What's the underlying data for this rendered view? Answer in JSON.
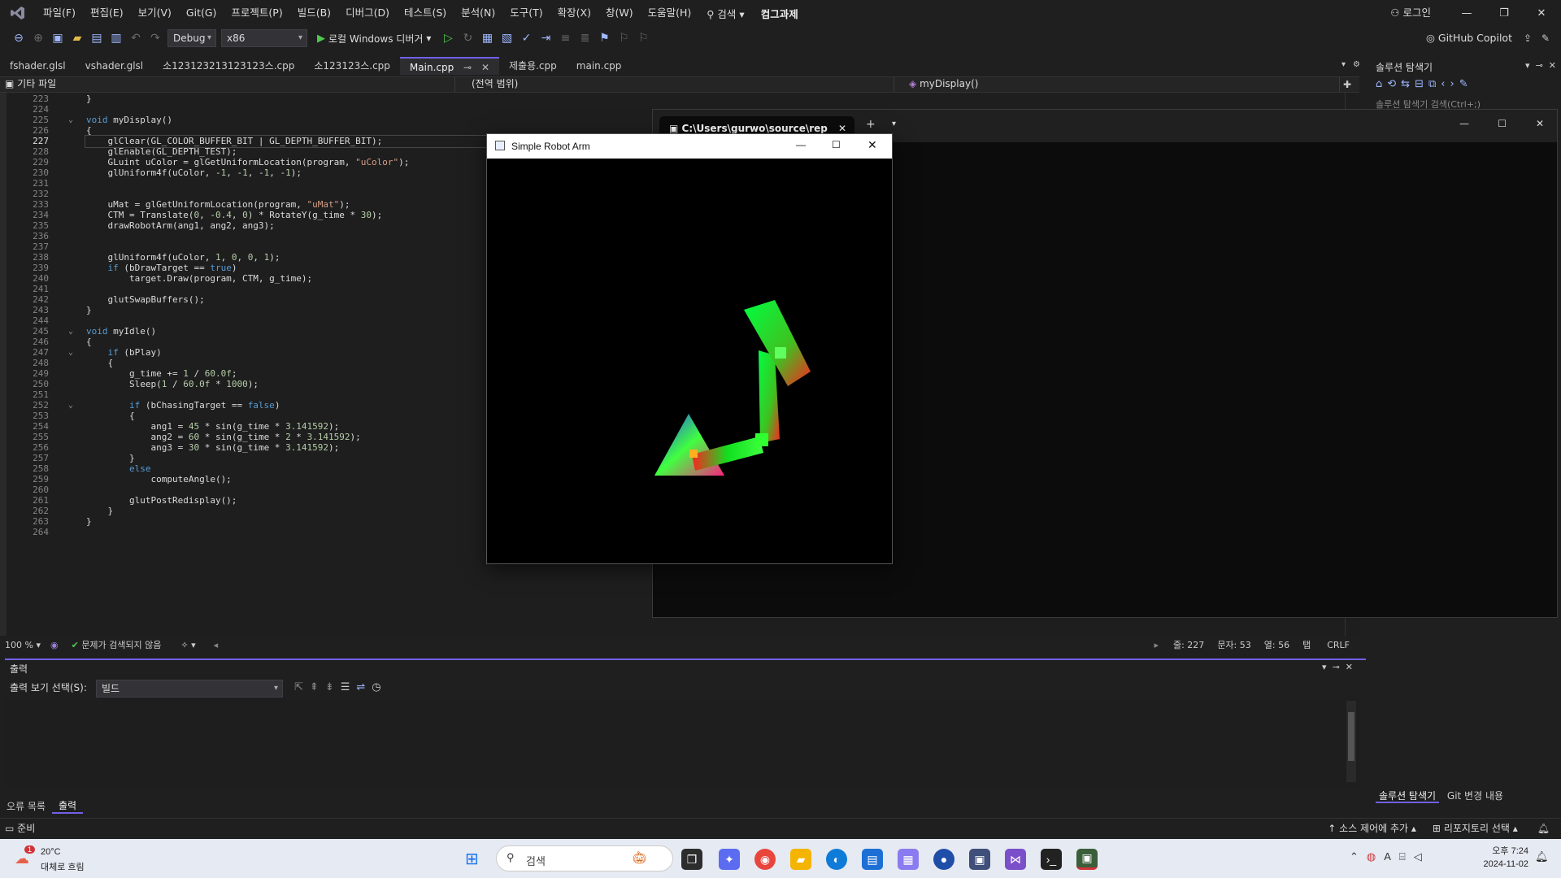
{
  "menubar": {
    "items": [
      "파일(F)",
      "편집(E)",
      "보기(V)",
      "Git(G)",
      "프로젝트(P)",
      "빌드(B)",
      "디버그(D)",
      "테스트(S)",
      "분석(N)",
      "도구(T)",
      "확장(X)",
      "창(W)",
      "도움말(H)"
    ],
    "search": "검색",
    "solution_name": "컴그과제",
    "login": "로그인"
  },
  "toolbar": {
    "config": "Debug",
    "platform": "x86",
    "run_label": "로컬 Windows 디버거",
    "copilot": "GitHub Copilot"
  },
  "tabs": [
    {
      "label": "fshader.glsl"
    },
    {
      "label": "vshader.glsl"
    },
    {
      "label": "소123123213123123스.cpp"
    },
    {
      "label": "소123123스.cpp"
    },
    {
      "label": "Main.cpp",
      "active": true
    },
    {
      "label": "제출용.cpp"
    },
    {
      "label": "main.cpp"
    }
  ],
  "navbar": {
    "project": "기타 파일",
    "scope": "(전역 범위)",
    "member": "myDisplay()"
  },
  "editor": {
    "current_line": 227,
    "lines": [
      {
        "n": "223",
        "t": "}"
      },
      {
        "n": "224",
        "t": ""
      },
      {
        "n": "225",
        "t": "void myDisplay()"
      },
      {
        "n": "226",
        "t": "{"
      },
      {
        "n": "227",
        "t": "    glClear(GL_COLOR_BUFFER_BIT | GL_DEPTH_BUFFER_BIT);"
      },
      {
        "n": "228",
        "t": "    glEnable(GL_DEPTH_TEST);"
      },
      {
        "n": "229",
        "t": "    GLuint uColor = glGetUniformLocation(program, \"uColor\");"
      },
      {
        "n": "230",
        "t": "    glUniform4f(uColor, -1, -1, -1, -1);"
      },
      {
        "n": "231",
        "t": ""
      },
      {
        "n": "232",
        "t": ""
      },
      {
        "n": "233",
        "t": "    uMat = glGetUniformLocation(program, \"uMat\");"
      },
      {
        "n": "234",
        "t": "    CTM = Translate(0, -0.4, 0) * RotateY(g_time * 30);"
      },
      {
        "n": "235",
        "t": "    drawRobotArm(ang1, ang2, ang3);"
      },
      {
        "n": "236",
        "t": ""
      },
      {
        "n": "237",
        "t": ""
      },
      {
        "n": "238",
        "t": "    glUniform4f(uColor, 1, 0, 0, 1);"
      },
      {
        "n": "239",
        "t": "    if (bDrawTarget == true)"
      },
      {
        "n": "240",
        "t": "        target.Draw(program, CTM, g_time);"
      },
      {
        "n": "241",
        "t": ""
      },
      {
        "n": "242",
        "t": "    glutSwapBuffers();"
      },
      {
        "n": "243",
        "t": "}"
      },
      {
        "n": "244",
        "t": ""
      },
      {
        "n": "245",
        "t": "void myIdle()"
      },
      {
        "n": "246",
        "t": "{"
      },
      {
        "n": "247",
        "t": "    if (bPlay)"
      },
      {
        "n": "248",
        "t": "    {"
      },
      {
        "n": "249",
        "t": "        g_time += 1 / 60.0f;"
      },
      {
        "n": "250",
        "t": "        Sleep(1 / 60.0f * 1000);"
      },
      {
        "n": "251",
        "t": ""
      },
      {
        "n": "252",
        "t": "        if (bChasingTarget == false)"
      },
      {
        "n": "253",
        "t": "        {"
      },
      {
        "n": "254",
        "t": "            ang1 = 45 * sin(g_time * 3.141592);"
      },
      {
        "n": "255",
        "t": "            ang2 = 60 * sin(g_time * 2 * 3.141592);"
      },
      {
        "n": "256",
        "t": "            ang3 = 30 * sin(g_time * 3.141592);"
      },
      {
        "n": "257",
        "t": "        }"
      },
      {
        "n": "258",
        "t": "        else"
      },
      {
        "n": "259",
        "t": "            computeAngle();"
      },
      {
        "n": "260",
        "t": ""
      },
      {
        "n": "261",
        "t": "        glutPostRedisplay();"
      },
      {
        "n": "262",
        "t": "    }"
      },
      {
        "n": "263",
        "t": "}"
      },
      {
        "n": "264",
        "t": ""
      }
    ],
    "zoom": "100 %",
    "issues": "문제가 검색되지 않음",
    "pos_line": "줄: 227",
    "pos_char": "문자: 53",
    "pos_col": "열: 56",
    "indent": "탭",
    "eol": "CRLF"
  },
  "output": {
    "title": "출력",
    "source_label": "출력 보기 선택(S):",
    "source_value": "빌드"
  },
  "bottom_tabs": [
    "오류 목록",
    "출력"
  ],
  "solution_explorer": {
    "title": "솔루션 탐색기",
    "search_placeholder": "솔루션 탐색기 검색(Ctrl+;)",
    "bottom_tabs": [
      "솔루션 탐색기",
      "Git 변경 내용"
    ]
  },
  "console": {
    "tab_title": "C:\\Users\\gurwo\\source\\rep"
  },
  "robot_window": {
    "title": "Simple Robot Arm"
  },
  "statusbar": {
    "ready": "준비",
    "source_control": "소스 제어에 추가",
    "repo": "리포지토리 선택"
  },
  "taskbar": {
    "weather_temp": "20°C",
    "weather_desc": "대체로 흐림",
    "weather_badge": "1",
    "search": "검색",
    "time": "오후 7:24",
    "date": "2024-11-02"
  },
  "colors": {
    "accent": "#7160e8",
    "editor_bg": "#1e1e1e",
    "chrome_bg": "#1f1f1f"
  }
}
